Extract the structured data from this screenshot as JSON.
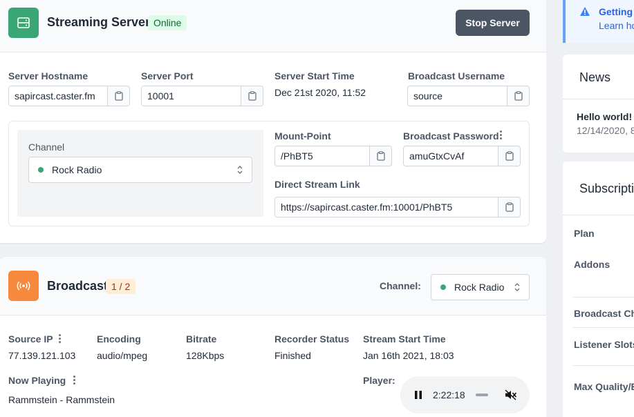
{
  "server": {
    "title": "Streaming Server",
    "status": "Online",
    "stop_label": "Stop Server",
    "hostname_label": "Server Hostname",
    "hostname": "sapircast.caster.fm",
    "port_label": "Server Port",
    "port": "10001",
    "start_label": "Server Start Time",
    "start_time": "Dec 21st 2020, 11:52",
    "username_label": "Broadcast Username",
    "username": "source",
    "channel_label": "Channel",
    "channel": "Rock Radio",
    "mount_label": "Mount-Point",
    "mount": "/PhBT5",
    "password_label": "Broadcast Password",
    "password": "amuGtxCvAf",
    "link_label": "Direct Stream Link",
    "link": "https://sapircast.caster.fm:10001/PhBT5"
  },
  "broadcast": {
    "title": "Broadcast",
    "count": "1 / 2",
    "channel_label": "Channel:",
    "channel": "Rock Radio",
    "source_ip_label": "Source IP",
    "source_ip": "77.139.121.103",
    "encoding_label": "Encoding",
    "encoding": "audio/mpeg",
    "bitrate_label": "Bitrate",
    "bitrate": "128Kbps",
    "recorder_label": "Recorder Status",
    "recorder": "Finished",
    "stream_start_label": "Stream Start Time",
    "stream_start": "Jan 16th 2021, 18:03",
    "now_playing_label": "Now Playing",
    "now_playing": "Rammstein - Rammstein",
    "player_label": "Player:",
    "player_time": "2:22:18"
  },
  "sidebar": {
    "info_title": "Getting",
    "info_link": "Learn ho",
    "news_title": "News",
    "news_item_title": "Hello world!",
    "news_item_date": "12/14/2020, 8",
    "subscription_title": "Subscripti",
    "rows": [
      "Plan",
      "Addons",
      "Broadcast Cha",
      "Listener Slots",
      "Max Quality/B"
    ]
  },
  "colors": {
    "green": "#3aa676",
    "orange": "#f6893b",
    "online_bg": "#dcfce7",
    "online_fg": "#166534",
    "count_bg": "#ffedd5",
    "count_fg": "#9a3412"
  }
}
